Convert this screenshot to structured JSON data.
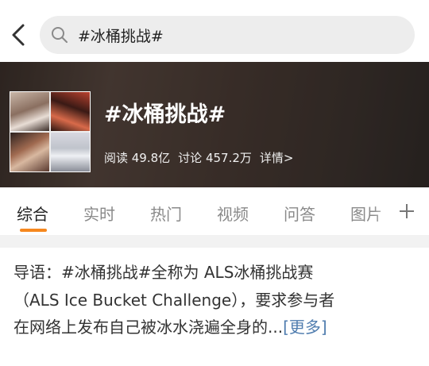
{
  "search": {
    "query": "#冰桶挑战#"
  },
  "banner": {
    "title": "#冰桶挑战#",
    "reads": "阅读 49.8亿",
    "discussions": "讨论 457.2万",
    "details_link": "详情>"
  },
  "tabs": [
    {
      "label": "综合",
      "active": true
    },
    {
      "label": "实时",
      "active": false
    },
    {
      "label": "热门",
      "active": false
    },
    {
      "label": "视频",
      "active": false
    },
    {
      "label": "问答",
      "active": false
    },
    {
      "label": "图片",
      "active": false
    }
  ],
  "intro": {
    "line1": "导语：#冰桶挑战#全称为 ALS冰桶挑战赛",
    "line2": "（ALS Ice Bucket Challenge），要求参与者",
    "line3": "在网络上发布自己被冰水浇遍全身的...",
    "more_link": "[更多]"
  },
  "colors": {
    "accent": "#f6881e",
    "link": "#507daf",
    "search_bg": "#ededed"
  },
  "icons": [
    "back-arrow-icon",
    "search-icon",
    "plus-icon"
  ]
}
